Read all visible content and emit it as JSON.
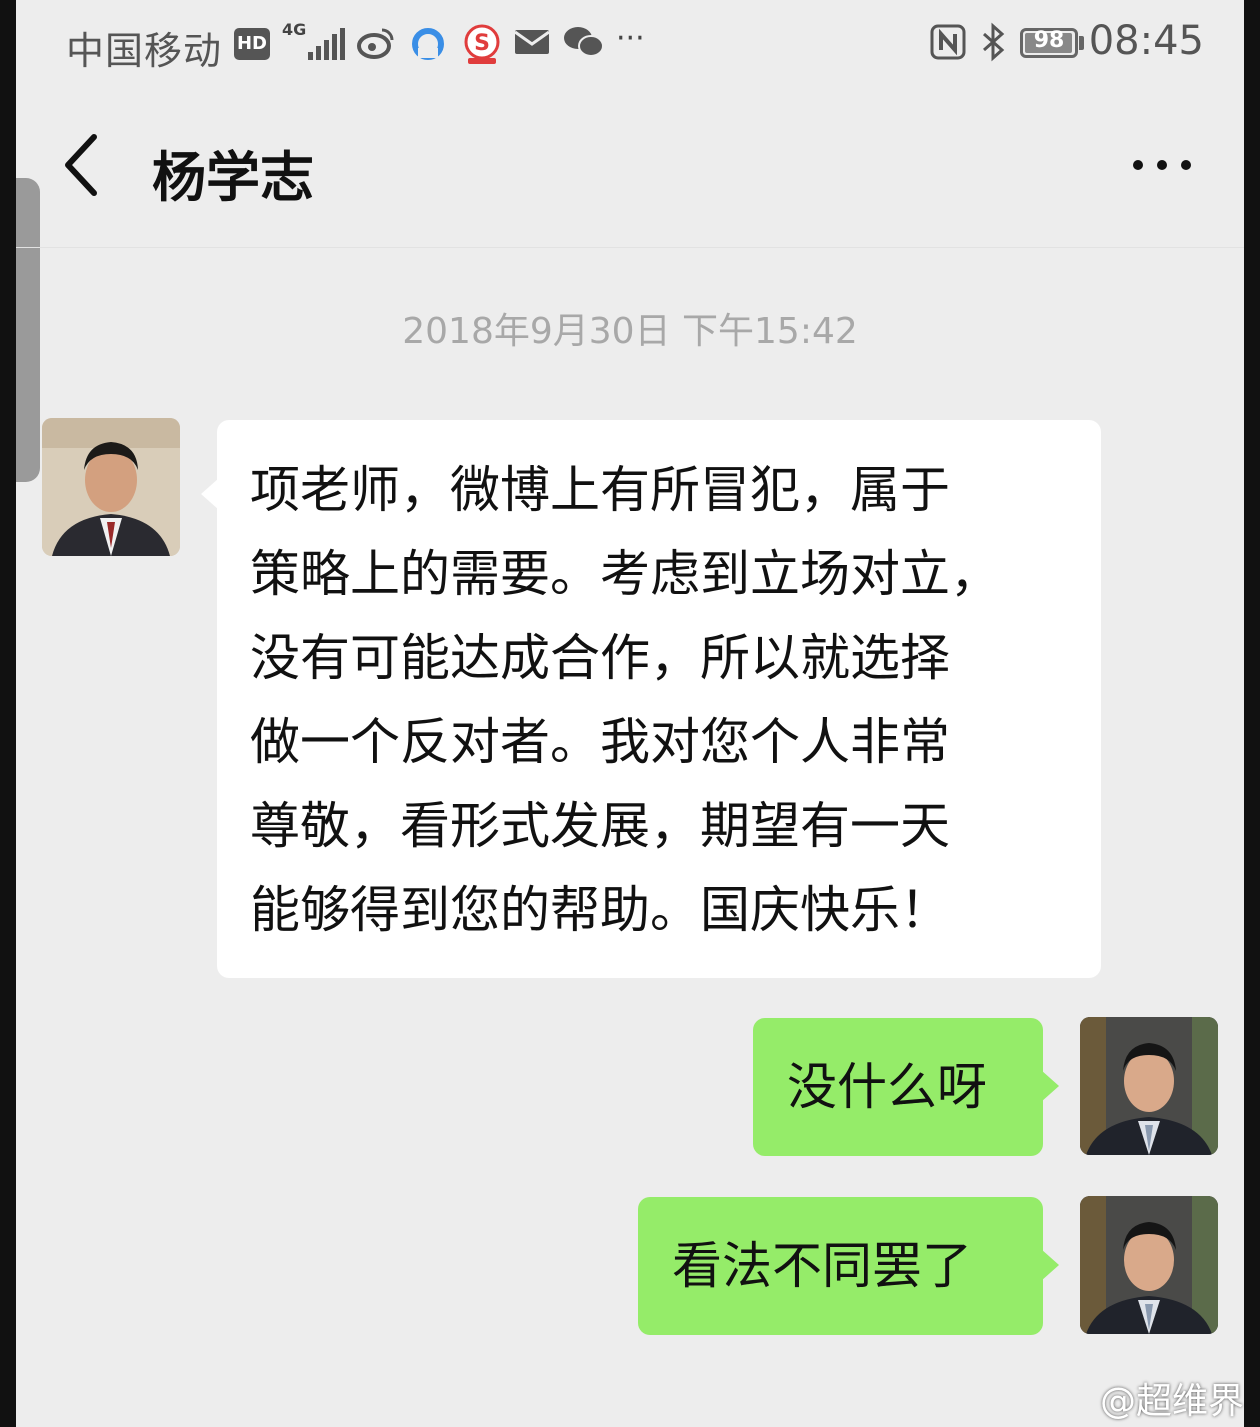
{
  "status_bar": {
    "carrier": "中国移动",
    "hd": "HD",
    "network": "4G",
    "icons": [
      "signal-icon",
      "weibo-icon",
      "browser-icon",
      "app-s-icon",
      "mail-icon",
      "wechat-icon",
      "more-notifications-icon",
      "nfc-icon",
      "bluetooth-icon"
    ],
    "more": "···",
    "battery": "98",
    "battery_level": 0.98,
    "time": "08:45"
  },
  "header": {
    "title": "杨学志",
    "back_icon": "chevron-left-icon",
    "more_icon": "more-dots-icon"
  },
  "chat": {
    "timestamp": "2018年9月30日 下午15:42",
    "messages": [
      {
        "direction": "incoming",
        "lines": [
          "项老师，微博上有所冒犯，属于",
          "策略上的需要。考虑到立场对立，",
          "没有可能达成合作，所以就选择",
          "做一个反对者。我对您个人非常",
          "尊敬，看形式发展，期望有一天",
          "能够得到您的帮助。国庆快乐！"
        ]
      },
      {
        "direction": "outgoing",
        "text": "没什么呀"
      },
      {
        "direction": "outgoing",
        "text": "看法不同罢了"
      }
    ]
  },
  "watermark": "@超维界",
  "colors": {
    "background": "#ededed",
    "incoming_bubble": "#ffffff",
    "outgoing_bubble": "#95ec69",
    "timestamp": "#a8a8a8"
  }
}
